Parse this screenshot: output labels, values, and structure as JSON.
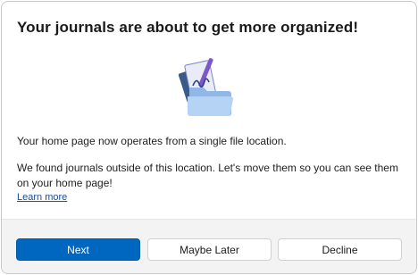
{
  "dialog": {
    "title": "Your journals are about to get more organized!",
    "paragraph1": "Your home page now operates from a single file location.",
    "paragraph2": "We found journals outside of this location. Let's move them so you can see them on your home page!",
    "learn_more": "Learn more"
  },
  "illustration": {
    "icon": "journal-folder-icon"
  },
  "buttons": {
    "next": "Next",
    "maybe_later": "Maybe Later",
    "decline": "Decline"
  },
  "colors": {
    "primary": "#0067c0",
    "link": "#1f4e8c",
    "footer_bg": "#f3f3f3"
  }
}
